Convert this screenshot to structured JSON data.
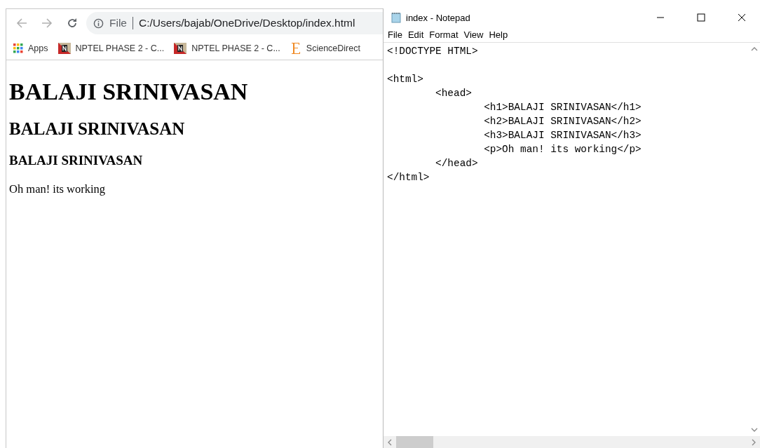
{
  "browser": {
    "address": {
      "scheme": "File",
      "url": "C:/Users/bajab/OneDrive/Desktop/index.html"
    },
    "bookmarks": [
      {
        "label": "Apps",
        "kind": "apps"
      },
      {
        "label": "NPTEL PHASE 2 - C...",
        "kind": "nptel"
      },
      {
        "label": "NPTEL PHASE 2 - C...",
        "kind": "nptel"
      },
      {
        "label": "ScienceDirect",
        "kind": "elsevier"
      }
    ],
    "page": [
      {
        "kind": "h1",
        "text": "BALAJI SRINIVASAN"
      },
      {
        "kind": "h2",
        "text": "BALAJI SRINIVASAN"
      },
      {
        "kind": "h3",
        "text": "BALAJI SRINIVASAN"
      },
      {
        "kind": "p",
        "text": "Oh man! its working"
      }
    ]
  },
  "notepad": {
    "title": "index - Notepad",
    "menu": [
      "File",
      "Edit",
      "Format",
      "View",
      "Help"
    ],
    "blocks": [
      [
        "<!DOCTYPE HTML>"
      ],
      [
        "<html>",
        "\t<head>",
        "\t\t<h1>BALAJI SRINIVASAN</h1>",
        "\t\t<h2>BALAJI SRINIVASAN</h2>",
        "\t\t<h3>BALAJI SRINIVASAN</h3>",
        "\t\t<p>Oh man! its working</p>",
        "\t</head>",
        "</html>"
      ]
    ]
  }
}
